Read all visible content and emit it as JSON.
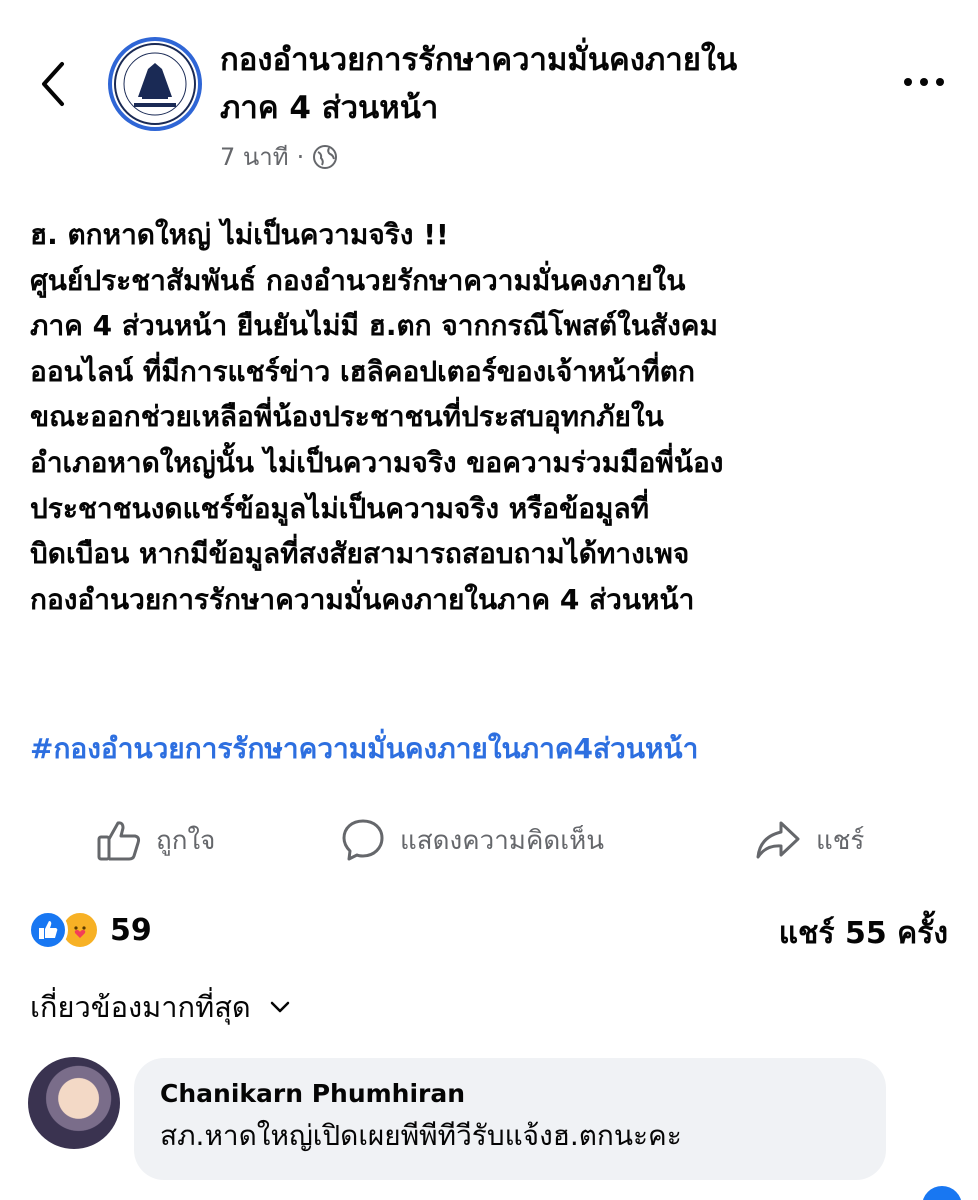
{
  "header": {
    "page_name_line1": "กองอำนวยการรักษาความมั่นคงภายใน",
    "page_name_line2": "ภาค 4 ส่วนหน้า",
    "time": "7 นาที",
    "separator": "·",
    "privacy_icon": "globe-icon",
    "back_icon": "chevron-left-icon",
    "more_icon": "more-horizontal-icon"
  },
  "post": {
    "lines": [
      "ฮ. ตกหาดใหญ่ ไม่เป็นความจริง !!",
      "ศูนย์ประชาสัมพันธ์ กองอำนวยรักษาความมั่นคงภายใน",
      "ภาค 4 ส่วนหน้า ยืนยันไม่มี ฮ.ตก จากกรณีโพสต์ในสังคม",
      "ออนไลน์ ที่มีการแชร์ข่าว เฮลิคอปเตอร์ของเจ้าหน้าที่ตก",
      "ขณะออกช่วยเหลือพี่น้องประชาชนที่ประสบอุทกภัยใน",
      "อำเภอหาดใหญ่นั้น ไม่เป็นความจริง ขอความร่วมมือพี่น้อง",
      "ประชาชนงดแชร์ข้อมูลไม่เป็นความจริง หรือข้อมูลที่",
      "บิดเบือน หากมีข้อมูลที่สงสัยสามารถสอบถามได้ทางเพจ",
      "กองอำนวยการรักษาความมั่นคงภายในภาค 4 ส่วนหน้า"
    ],
    "hashtag": "#กองอำนวยการรักษาความมั่นคงภายในภาค4ส่วนหน้า"
  },
  "actions": {
    "like_label": "ถูกใจ",
    "comment_label": "แสดงความคิดเห็น",
    "share_label": "แชร์"
  },
  "stats": {
    "reaction_count": "59",
    "shares_text": "แชร์ 55 ครั้ง",
    "reaction_icons": [
      "like-icon",
      "care-icon"
    ]
  },
  "comments_sort": {
    "label": "เกี่ยวข้องมากที่สุด"
  },
  "comment": {
    "author": "Chanikarn Phumhiran",
    "text": "สภ.หาดใหญ่เปิดเผยพีพีทีวีรับแจ้งฮ.ตกนะคะ"
  },
  "colors": {
    "text": "#050505",
    "secondary": "#65676b",
    "link": "#2d6fe0",
    "like_blue": "#1877f2",
    "bubble": "#f0f2f5"
  }
}
